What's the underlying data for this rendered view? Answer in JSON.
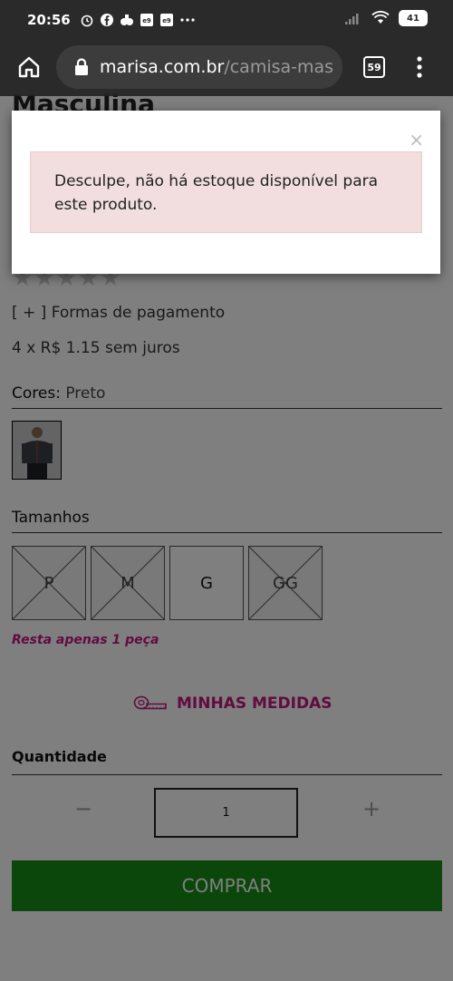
{
  "status_bar": {
    "time": "20:56",
    "battery": "41",
    "icons": [
      "alarm-icon",
      "facebook-icon",
      "app-icon",
      "badge-icon",
      "badge-icon",
      "more-dots-icon",
      "signal-icon",
      "wifi-icon",
      "battery-icon"
    ]
  },
  "browser": {
    "url_domain": "marisa.com.br",
    "url_path": "/camisa-mas",
    "tab_count": "59"
  },
  "product": {
    "title": "Masculina",
    "payment_link": "[ + ] Formas de pagamento",
    "installments": "4 x R$ 1.15 sem juros",
    "colors_label": "Cores:",
    "colors_value": "Preto",
    "sizes_label": "Tamanhos",
    "sizes": [
      {
        "label": "P",
        "available": false
      },
      {
        "label": "M",
        "available": false
      },
      {
        "label": "G",
        "available": true
      },
      {
        "label": "GG",
        "available": false
      }
    ],
    "stock_note": "Resta apenas 1 peça",
    "measures_label": "MINHAS MEDIDAS",
    "quantity_label": "Quantidade",
    "quantity_value": "1",
    "minus": "−",
    "plus": "+",
    "buy_label": "COMPRAR"
  },
  "modal": {
    "close": "×",
    "message": "Desculpe, não há estoque disponível para este produto."
  },
  "colors": {
    "accent_pink": "#c2187a",
    "buy_green": "#168c16",
    "alert_bg": "#f2dede"
  }
}
